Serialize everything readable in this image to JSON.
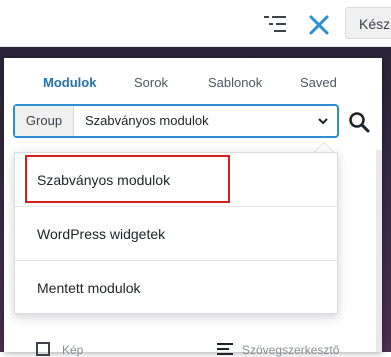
{
  "toolbar": {
    "done_label": "Kész",
    "icons": [
      "list-view-icon",
      "close-icon"
    ],
    "accent": "#2c8fd1"
  },
  "panel": {
    "tabs": [
      {
        "label": "Modulok",
        "active": true
      },
      {
        "label": "Sorok",
        "active": false
      },
      {
        "label": "Sablonok",
        "active": false
      },
      {
        "label": "Saved",
        "active": false
      }
    ],
    "group": {
      "prefix": "Group",
      "selected": "Szabványos modulok"
    },
    "dropdown": {
      "options": [
        "Szabványos modulok",
        "WordPress widgetek",
        "Mentett modulok"
      ],
      "highlighted": "Szabványos modulok",
      "highlight_color": "#d61f1f"
    },
    "under_items": [
      "Kép",
      "Szövegszerkesztő"
    ]
  }
}
